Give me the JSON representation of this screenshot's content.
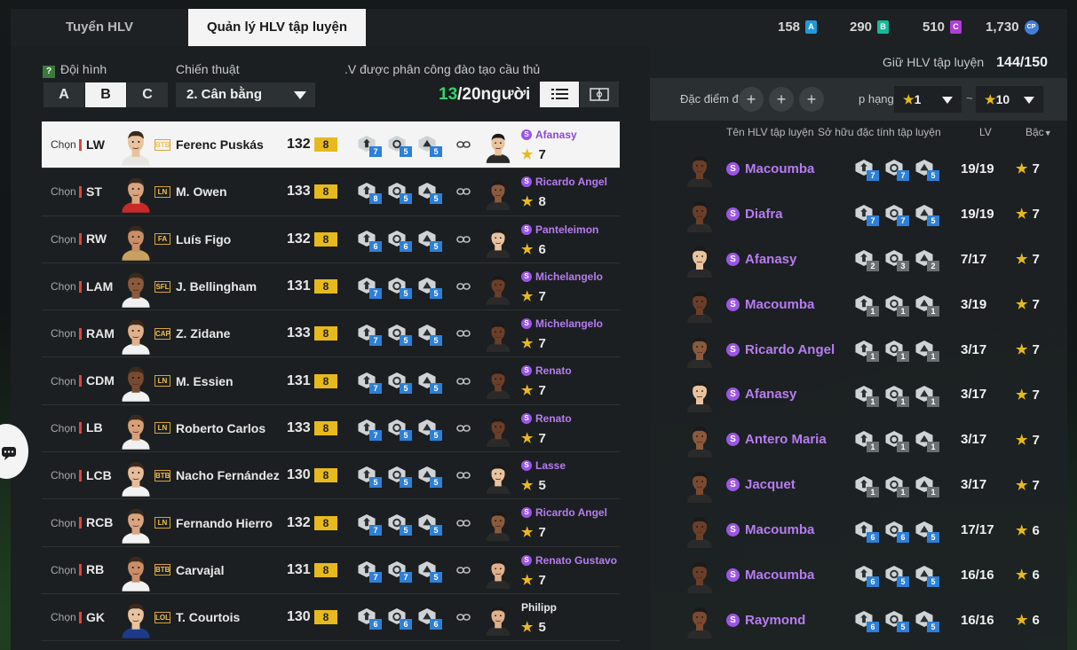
{
  "tabs": [
    {
      "label": "Tuyển HLV"
    },
    {
      "label": "Quản lý HLV tập luyện"
    }
  ],
  "currencies": [
    {
      "value": "158",
      "icon": "currency-a-icon",
      "letter": "A",
      "color": "#1e9bd8"
    },
    {
      "value": "290",
      "icon": "currency-b-icon",
      "letter": "B",
      "color": "#16b89a"
    },
    {
      "value": "510",
      "icon": "currency-c-icon",
      "letter": "C",
      "color": "#b13cd6"
    },
    {
      "value": "1,730",
      "icon": "coin-icon",
      "letter": "CP",
      "color": "#3f7fd6"
    }
  ],
  "left": {
    "squad_label": "Đội hình",
    "squad_options": [
      "A",
      "B",
      "C"
    ],
    "squad_selected": "B",
    "tactic_label": "Chiến thuật",
    "tactic_value": "2. Cân bằng",
    "assigned_label": ".V được phân công đào tạo cầu thủ",
    "assigned_count": "13",
    "assigned_total": "/20người",
    "view_mode": "list"
  },
  "players": [
    {
      "pos": "LW",
      "badge": "BTB",
      "name": "Ferenc Puskás",
      "ovr": "132",
      "level": "8",
      "traits": [
        "7",
        "5",
        "5"
      ],
      "coach": "Afanasy",
      "coach_stars": "7",
      "special": true,
      "selected": true
    },
    {
      "pos": "ST",
      "badge": "LN",
      "name": "M. Owen",
      "ovr": "133",
      "level": "8",
      "traits": [
        "8",
        "5",
        "5"
      ],
      "coach": "Ricardo Angel",
      "coach_stars": "8",
      "special": true
    },
    {
      "pos": "RW",
      "badge": "FA",
      "name": "Luís Figo",
      "ovr": "132",
      "level": "8",
      "traits": [
        "6",
        "6",
        "5"
      ],
      "coach": "Panteleimon",
      "coach_stars": "6",
      "special": true
    },
    {
      "pos": "LAM",
      "badge": "SFL",
      "name": "J. Bellingham",
      "ovr": "131",
      "level": "8",
      "traits": [
        "7",
        "5",
        "5"
      ],
      "coach": "Michelangelo",
      "coach_stars": "7",
      "special": true
    },
    {
      "pos": "RAM",
      "badge": "CAP",
      "name": "Z. Zidane",
      "ovr": "133",
      "level": "8",
      "traits": [
        "7",
        "5",
        "5"
      ],
      "coach": "Michelangelo",
      "coach_stars": "7",
      "special": true
    },
    {
      "pos": "CDM",
      "badge": "LN",
      "name": "M. Essien",
      "ovr": "131",
      "level": "8",
      "traits": [
        "7",
        "5",
        "5"
      ],
      "coach": "Renato",
      "coach_stars": "7",
      "special": true
    },
    {
      "pos": "LB",
      "badge": "LN",
      "name": "Roberto Carlos",
      "ovr": "133",
      "level": "8",
      "traits": [
        "7",
        "5",
        "5"
      ],
      "coach": "Renato",
      "coach_stars": "7",
      "special": true
    },
    {
      "pos": "LCB",
      "badge": "BTB",
      "name": "Nacho Fernández",
      "ovr": "130",
      "level": "8",
      "traits": [
        "5",
        "5",
        "5"
      ],
      "coach": "Lasse",
      "coach_stars": "5",
      "special": true
    },
    {
      "pos": "RCB",
      "badge": "LN",
      "name": "Fernando Hierro",
      "ovr": "132",
      "level": "8",
      "traits": [
        "7",
        "5",
        "5"
      ],
      "coach": "Ricardo Angel",
      "coach_stars": "7",
      "special": true
    },
    {
      "pos": "RB",
      "badge": "BTB",
      "name": "Carvajal",
      "ovr": "131",
      "level": "8",
      "traits": [
        "7",
        "7",
        "5"
      ],
      "coach": "Renato Gustavo",
      "coach_stars": "7",
      "special": true
    },
    {
      "pos": "GK",
      "badge": "LOL",
      "name": "T. Courtois",
      "ovr": "130",
      "level": "8",
      "traits": [
        "6",
        "6",
        "6"
      ],
      "coach": "Philipp",
      "coach_stars": "5",
      "special": false
    }
  ],
  "right": {
    "keep_label": "Giữ HLV tập luyện",
    "keep_value": "144/150",
    "trait_filter_label": "Đặc điểm đ",
    "rank_label": "p hạng",
    "rank_from": "1",
    "rank_to": "10",
    "rank_sep": "~",
    "headers": {
      "name": "Tên HLV tập luyện",
      "traits": "Sở hữu đặc tính tập luyện",
      "lv": "LV",
      "tier": "Bậc"
    }
  },
  "coaches": [
    {
      "name": "Macoumba",
      "traits": [
        "7",
        "7",
        "5"
      ],
      "lv": "19/19",
      "stars": "7"
    },
    {
      "name": "Diafra",
      "traits": [
        "7",
        "7",
        "5"
      ],
      "lv": "19/19",
      "stars": "7"
    },
    {
      "name": "Afanasy",
      "traits": [
        "2",
        "3",
        "2"
      ],
      "lv": "7/17",
      "stars": "7"
    },
    {
      "name": "Macoumba",
      "traits": [
        "1",
        "1",
        "1"
      ],
      "lv": "3/19",
      "stars": "7"
    },
    {
      "name": "Ricardo Angel",
      "traits": [
        "1",
        "1",
        "1"
      ],
      "lv": "3/17",
      "stars": "7"
    },
    {
      "name": "Afanasy",
      "traits": [
        "1",
        "1",
        "1"
      ],
      "lv": "3/17",
      "stars": "7"
    },
    {
      "name": "Antero Maria",
      "traits": [
        "1",
        "1",
        "1"
      ],
      "lv": "3/17",
      "stars": "7"
    },
    {
      "name": "Jacquet",
      "traits": [
        "1",
        "1",
        "1"
      ],
      "lv": "3/17",
      "stars": "7"
    },
    {
      "name": "Macoumba",
      "traits": [
        "6",
        "6",
        "5"
      ],
      "lv": "17/17",
      "stars": "6"
    },
    {
      "name": "Macoumba",
      "traits": [
        "6",
        "5",
        "5"
      ],
      "lv": "16/16",
      "stars": "6"
    },
    {
      "name": "Raymond",
      "traits": [
        "6",
        "5",
        "5"
      ],
      "lv": "16/16",
      "stars": "6"
    }
  ]
}
